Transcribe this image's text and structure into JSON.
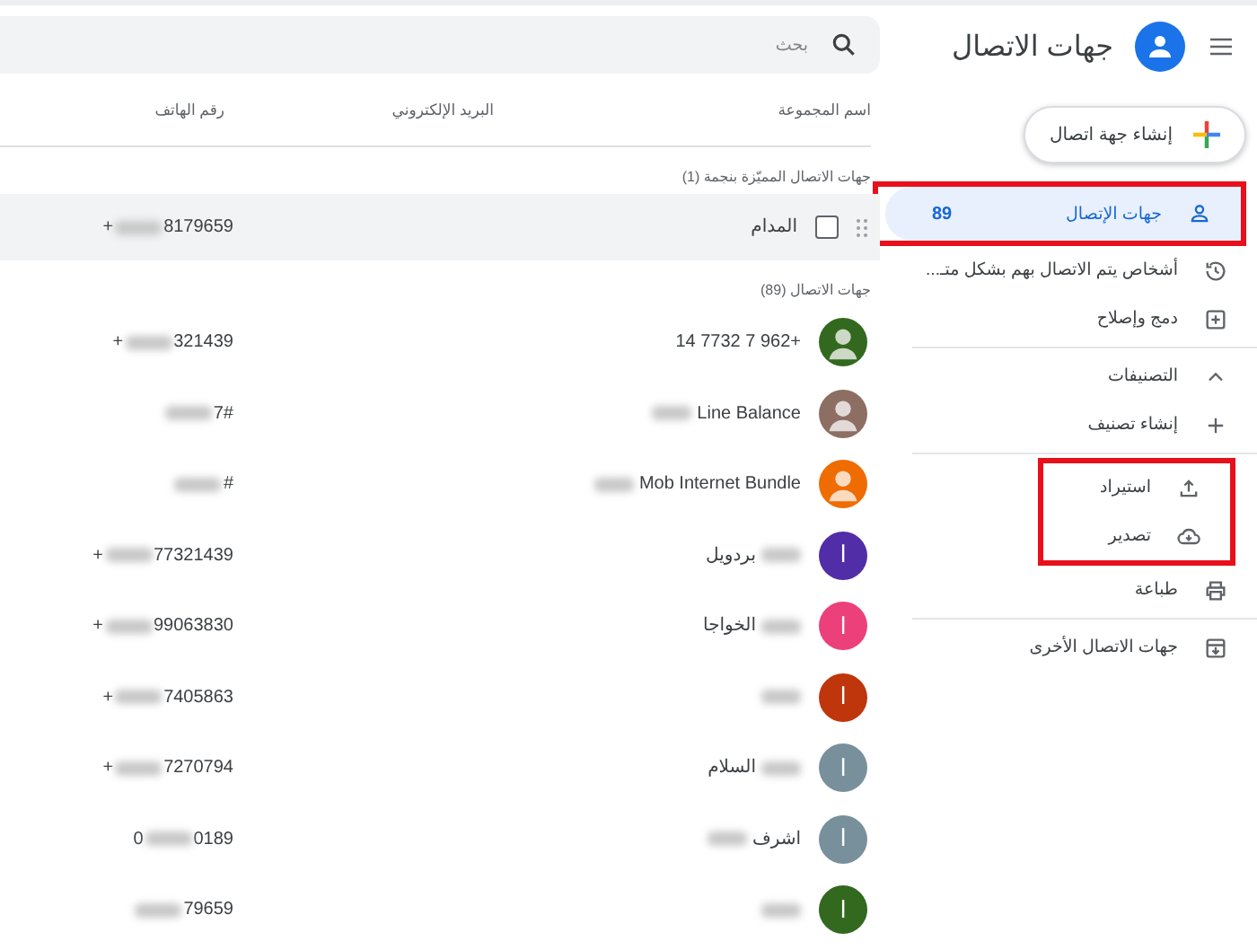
{
  "app_bar": {
    "title": "جهات الاتصال"
  },
  "create_button": {
    "label": "إنشاء جهة اتصال"
  },
  "sidebar": {
    "groups": [
      {
        "items": [
          {
            "kind": "person",
            "label": "جهات الإتصال",
            "count": "89",
            "selected": true,
            "framed": true
          },
          {
            "kind": "history",
            "label": "أشخاص يتم الاتصال بهم بشكل متـ...",
            "selected": false,
            "framed": false
          },
          {
            "kind": "merge",
            "label": "دمج وإصلاح",
            "selected": false,
            "framed": false
          }
        ]
      },
      {
        "items": [
          {
            "kind": "chevron",
            "label": "التصنيفات",
            "expanded": true,
            "selected": false,
            "framed": false
          },
          {
            "kind": "plus",
            "label": "إنشاء تصنيف",
            "selected": false,
            "framed": false
          }
        ]
      },
      {
        "items": [
          {
            "kind": "upload",
            "label": "استيراد",
            "selected": false,
            "framed": true
          },
          {
            "kind": "cloud",
            "label": "تصدير",
            "selected": false,
            "framed": true
          },
          {
            "kind": "print",
            "label": "طباعة",
            "selected": false,
            "framed": false
          }
        ]
      },
      {
        "items": [
          {
            "kind": "archive",
            "label": "جهات الاتصال الأخرى",
            "selected": false,
            "framed": false
          }
        ]
      }
    ]
  },
  "search": {
    "placeholder": "بحث"
  },
  "table": {
    "columns": [
      "اسم المجموعة",
      "البريد الإلكتروني",
      "رقم الهاتف"
    ],
    "starred_header": "جهات الاتصال المميّزة بنجمة (1)",
    "starred": [
      {
        "name_parts": [
          {
            "kind": "text",
            "text": "المدام"
          }
        ],
        "checked": false,
        "phone_head": "+",
        "phone_tail": "8179659"
      }
    ],
    "contacts_header": "جهات الاتصال (89)",
    "rows": [
      {
        "kind": "photo",
        "color": "#33691e",
        "name_parts": [
          {
            "kind": "text",
            "text": "14 7732 7 962+"
          }
        ],
        "phone_head": "+",
        "phone_tail": "321439"
      },
      {
        "kind": "photo",
        "color": "#8d6e63",
        "name_parts": [
          {
            "kind": "text",
            "text": "Line Balance"
          },
          {
            "kind": "blur"
          }
        ],
        "phone_head": "",
        "phone_tail": "7#"
      },
      {
        "kind": "photo",
        "color": "#ef6c00",
        "name_parts": [
          {
            "kind": "text",
            "text": "Mob Internet Bundle"
          },
          {
            "kind": "blur"
          }
        ],
        "phone_head": "",
        "phone_tail": "#"
      },
      {
        "kind": "letter",
        "letter": "ا",
        "color": "#512da8",
        "name_parts": [
          {
            "kind": "blur"
          },
          {
            "kind": "text",
            "text": "بردويل"
          }
        ],
        "phone_head": "+",
        "phone_tail": "77321439"
      },
      {
        "kind": "letter",
        "letter": "ا",
        "color": "#ec407a",
        "name_parts": [
          {
            "kind": "blur"
          },
          {
            "kind": "text",
            "text": "الخواجا"
          }
        ],
        "phone_head": "+",
        "phone_tail": "99063830"
      },
      {
        "kind": "letter",
        "letter": "ا",
        "color": "#bf360c",
        "name_parts": [
          {
            "kind": "blur"
          }
        ],
        "phone_head": "+",
        "phone_tail": "7405863"
      },
      {
        "kind": "letter",
        "letter": "ا",
        "color": "#78909c",
        "name_parts": [
          {
            "kind": "blur"
          },
          {
            "kind": "text",
            "text": "السلام"
          }
        ],
        "phone_head": "+",
        "phone_tail": "7270794"
      },
      {
        "kind": "letter",
        "letter": "ا",
        "color": "#78909c",
        "name_parts": [
          {
            "kind": "text",
            "text": "اشرف"
          },
          {
            "kind": "blur"
          }
        ],
        "phone_head": "0",
        "phone_tail": "0189"
      },
      {
        "kind": "letter",
        "letter": "ا",
        "color": "#33691e",
        "name_parts": [
          {
            "kind": "blur"
          }
        ],
        "phone_head": "",
        "phone_tail": "79659"
      }
    ]
  }
}
